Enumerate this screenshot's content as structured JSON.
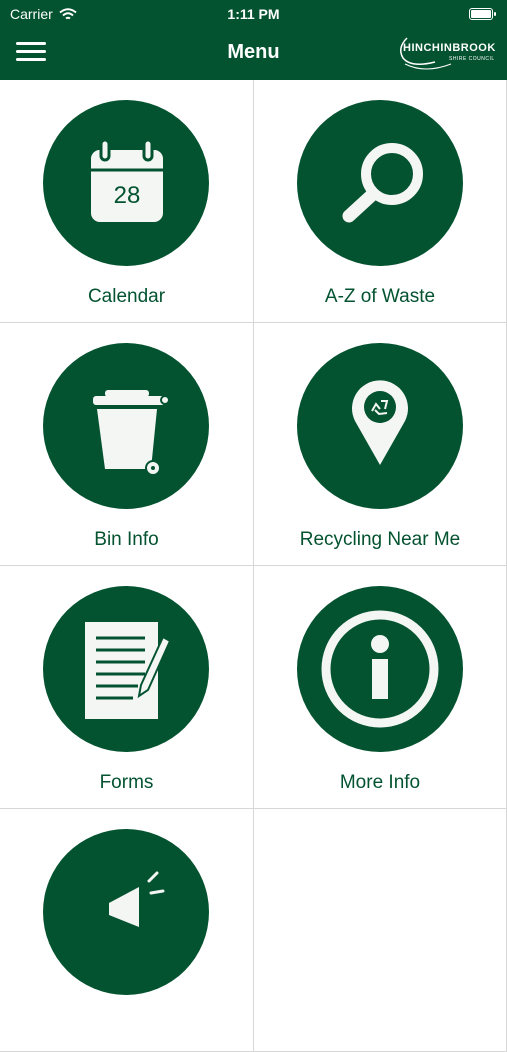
{
  "status_bar": {
    "carrier": "Carrier",
    "time": "1:11 PM"
  },
  "header": {
    "title": "Menu",
    "logo_brand": "HINCHINBROOK",
    "logo_sub": "SHIRE COUNCIL"
  },
  "menu": {
    "items": [
      {
        "label": "Calendar",
        "icon": "calendar-icon",
        "calendar_day": "28"
      },
      {
        "label": "A-Z of Waste",
        "icon": "search-icon"
      },
      {
        "label": "Bin Info",
        "icon": "bin-icon"
      },
      {
        "label": "Recycling Near Me",
        "icon": "map-pin-recycle-icon"
      },
      {
        "label": "Forms",
        "icon": "form-pencil-icon"
      },
      {
        "label": "More Info",
        "icon": "info-icon"
      },
      {
        "label": "",
        "icon": "megaphone-icon"
      }
    ]
  },
  "colors": {
    "brand": "#045330",
    "background": "#ffffff",
    "divider": "#d7d7d7"
  }
}
